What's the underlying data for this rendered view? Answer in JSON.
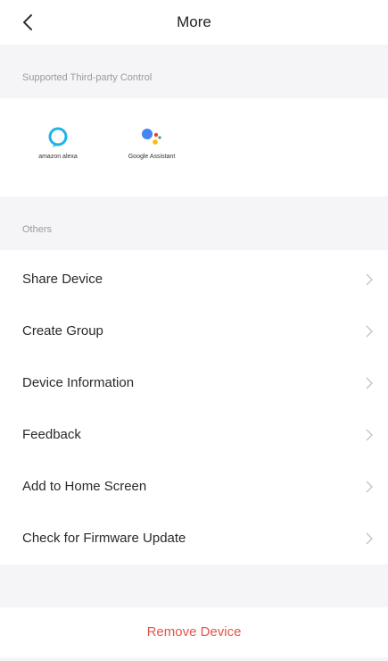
{
  "header": {
    "title": "More",
    "back_icon": "chevron-left-icon"
  },
  "third_party": {
    "section_label": "Supported Third-party Control",
    "services": [
      {
        "name": "amazon alexa",
        "icon": "alexa-icon",
        "color": "#1fb3e8"
      },
      {
        "name": "Google Assistant",
        "icon": "google-assistant-icon",
        "colors": [
          "#4285f4",
          "#ea4335",
          "#fbbc05",
          "#34a853"
        ]
      }
    ]
  },
  "others": {
    "section_label": "Others",
    "items": [
      {
        "label": "Share Device"
      },
      {
        "label": "Create Group"
      },
      {
        "label": "Device Information"
      },
      {
        "label": "Feedback"
      },
      {
        "label": "Add to Home Screen"
      },
      {
        "label": "Check for Firmware Update"
      }
    ]
  },
  "remove": {
    "label": "Remove Device",
    "color": "#e5534b"
  }
}
